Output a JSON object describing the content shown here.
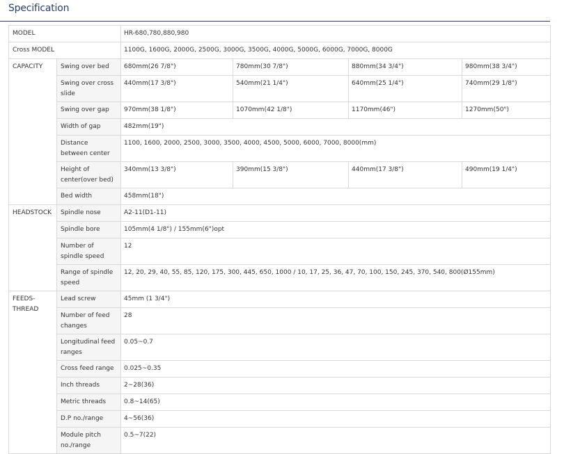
{
  "title": "Specification",
  "rows": {
    "model": {
      "label": "MODEL",
      "value": "HR-680,780,880,980"
    },
    "cross_model": {
      "label": "Cross MODEL",
      "value": "1100G, 1600G, 2000G, 2500G, 3000G, 3500G, 4000G, 5000G, 6000G, 7000G, 8000G"
    },
    "capacity": {
      "label": "CAPACITY",
      "swing_over_bed": {
        "label": "Swing over bed",
        "values": [
          "680mm(26 7/8\")",
          "780mm(30 7/8\")",
          "880mm(34 3/4\")",
          "980mm(38 3/4\")"
        ]
      },
      "swing_over_cross_slide": {
        "label": "Swing over cross slide",
        "values": [
          "440mm(17 3/8\")",
          "540mm(21 1/4\")",
          "640mm(25 1/4\")",
          "740mm(29 1/8\")"
        ]
      },
      "swing_over_gap": {
        "label": "Swing over gap",
        "values": [
          "970mm(38 1/8\")",
          "1070mm(42 1/8\")",
          "1170mm(46\")",
          "1270mm(50\")"
        ]
      },
      "width_of_gap": {
        "label": "Width of gap",
        "value": "482mm(19\")"
      },
      "distance_between_center": {
        "label": "Distance between center",
        "value": "1100, 1600, 2000, 2500, 3000, 3500, 4000, 4500, 5000, 6000, 7000, 8000(mm)"
      },
      "height_of_center": {
        "label": "Height of center(over bed)",
        "values": [
          "340mm(13 3/8\")",
          "390mm(15 3/8\")",
          "440mm(17 3/8\")",
          "490mm(19 1/4\")"
        ]
      },
      "bed_width": {
        "label": "Bed width",
        "value": "458mm(18\")"
      }
    },
    "headstock": {
      "label": "HEADSTOCK",
      "spindle_nose": {
        "label": "Spindle nose",
        "value": "A2-11(D1-11)"
      },
      "spindle_bore": {
        "label": "Spindle bore",
        "value": "105mm(4 1/8\") / 155mm(6\")opt"
      },
      "number_of_spindle_speed": {
        "label": "Number of spindle speed",
        "value": "12"
      },
      "range_of_spindle_speed": {
        "label": "Range of spindle speed",
        "value": "12, 20, 29, 40, 55, 85, 120, 175, 300, 445, 650, 1000 / 10, 17, 25, 36, 47, 70, 100, 150, 245, 370, 540, 800(Ø155mm)"
      }
    },
    "feeds_thread": {
      "label": "FEEDS-THREAD",
      "lead_screw": {
        "label": "Lead screw",
        "value": "45mm (1 3/4\")"
      },
      "number_of_feed_changes": {
        "label": "Number of feed changes",
        "value": "28"
      },
      "longitudinal_feed_ranges": {
        "label": "Longitudinal feed ranges",
        "value": "0.05~0.7"
      },
      "cross_feed_range": {
        "label": "Cross feed range",
        "value": "0.025~0.35"
      },
      "inch_threads": {
        "label": "Inch threads",
        "value": "2~28(36)"
      },
      "metric_threads": {
        "label": "Metric threads",
        "value": "0.8~14(65)"
      },
      "dp_range": {
        "label": "D.P no./range",
        "value": "4~56(36)"
      },
      "module_pitch": {
        "label": "Module pitch no./range",
        "value": "0.5~7(22)"
      }
    }
  }
}
